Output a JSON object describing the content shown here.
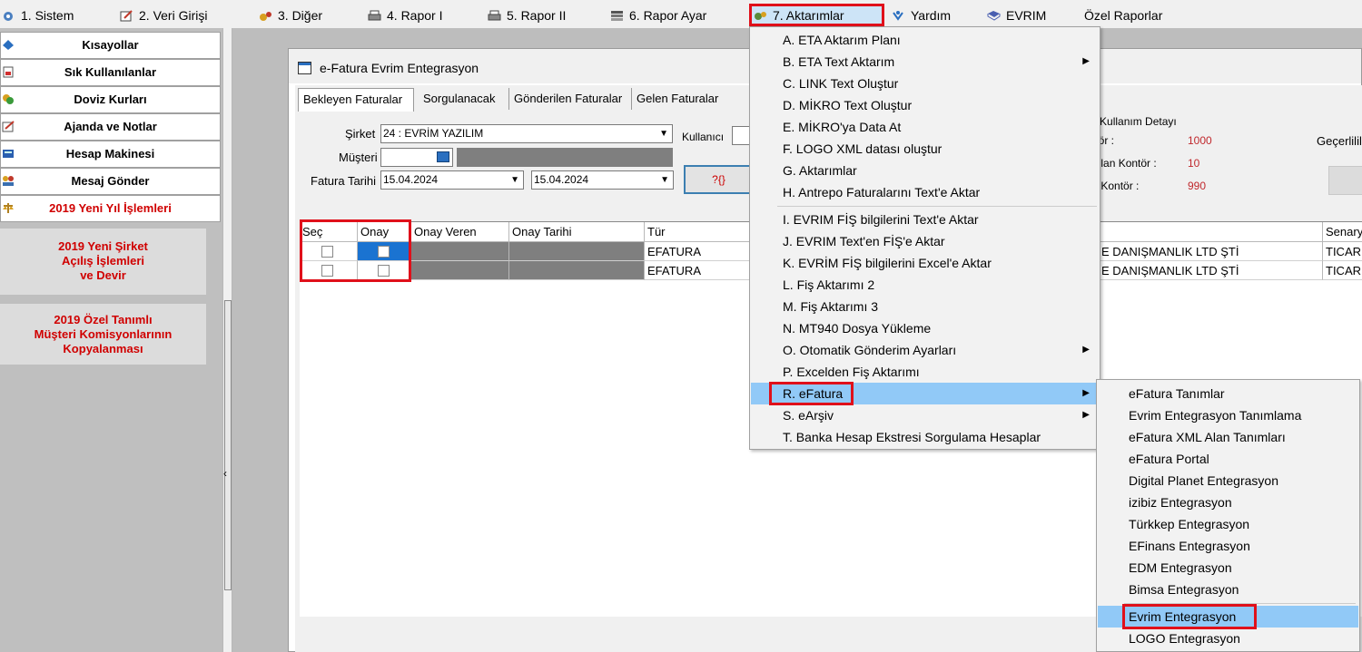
{
  "menubar": {
    "items": [
      {
        "label": "1.  Sistem",
        "icon": "settings-icon"
      },
      {
        "label": "2.  Veri Girişi",
        "icon": "edit-icon"
      },
      {
        "label": "3.  Diğer",
        "icon": "gears-icon"
      },
      {
        "label": "4.  Rapor I",
        "icon": "printer-icon"
      },
      {
        "label": "5.  Rapor II",
        "icon": "printer-icon"
      },
      {
        "label": "6.  Rapor Ayar",
        "icon": "report-settings-icon"
      },
      {
        "label": "7.  Aktarımlar",
        "icon": "transfer-icon"
      },
      {
        "label": "Yardım",
        "icon": "help-icon"
      },
      {
        "label": "EVRIM",
        "icon": "book-icon"
      },
      {
        "label": "Özel Raporlar",
        "icon": ""
      }
    ]
  },
  "leftpanel": {
    "items": [
      {
        "label": "Kısayollar"
      },
      {
        "label": "Sık Kullanılanlar"
      },
      {
        "label": "Doviz Kurları"
      },
      {
        "label": "Ajanda ve Notlar"
      },
      {
        "label": "Hesap Makinesi"
      },
      {
        "label": "Mesaj Gönder"
      },
      {
        "label": "2019 Yeni Yıl İşlemleri"
      }
    ],
    "buttons": [
      {
        "label": "2019 Yeni Şirket\nAçılış İşlemleri\nve Devir"
      },
      {
        "label": "2019 Özel Tanımlı\nMüşteri Komisyonlarının\nKopyalanması"
      }
    ]
  },
  "window": {
    "title": "e-Fatura Evrim Entegrasyon",
    "tabs": [
      "Bekleyen Faturalar",
      "Sorgulanacak",
      "Gönderilen Faturalar",
      "Gelen Faturalar"
    ],
    "form": {
      "sirket_label": "Şirket",
      "sirket_value": "24 : EVRİM YAZILIM",
      "musteri_label": "Müşteri",
      "fatura_tarihi_label": "Fatura Tarihi",
      "date_from": "15.04.2024",
      "date_to": "15.04.2024",
      "kullanici_label": "Kullanıcı",
      "query_button": "?{}"
    },
    "kontor": {
      "title": "ntör Kullanım Detayı",
      "kontor_label": "ontör :",
      "kontor_value": "1000",
      "used_label": "lanılan Kontör :",
      "used_value": "10",
      "remaining_label": "lan Kontör :",
      "remaining_value": "990",
      "gecerlilik_label": "Geçerlilil"
    },
    "grid": {
      "headers": [
        "Seç",
        "Onay",
        "Onay Veren",
        "Onay Tarihi",
        "Tür",
        "Senary"
      ],
      "rows": [
        {
          "tur": "EFATURA",
          "unvan": "E DANIŞMANLIK LTD ŞTİ",
          "senaryo": "TICAR"
        },
        {
          "tur": "EFATURA",
          "unvan": "E DANIŞMANLIK LTD ŞTİ",
          "senaryo": "TICAR"
        }
      ]
    }
  },
  "aktarimlar_menu": {
    "items": [
      {
        "label": "A.   ETA Aktarım Planı"
      },
      {
        "label": "B.   ETA Text Aktarım",
        "has_submenu": true
      },
      {
        "label": "C.   LINK Text Oluştur"
      },
      {
        "label": "D.   MİKRO Text Oluştur"
      },
      {
        "label": "E.   MİKRO'ya  Data  At"
      },
      {
        "label": "F.   LOGO XML datası oluştur"
      },
      {
        "label": "G.   Aktarımlar"
      },
      {
        "label": "H.   Antrepo Faturalarını Text'e Aktar"
      },
      {
        "label": "I.    EVRIM FİŞ bilgilerini Text'e Aktar"
      },
      {
        "label": "J.    EVRIM Text'en FİŞ'e Aktar"
      },
      {
        "label": "K.    EVRİM FİŞ bilgilerini Excel'e Aktar"
      },
      {
        "label": "L.    Fiş Aktarımı 2"
      },
      {
        "label": "M.   Fiş Aktarımı 3"
      },
      {
        "label": "N.   MT940 Dosya Yükleme"
      },
      {
        "label": "O. Otomatik Gönderim Ayarları",
        "has_submenu": true
      },
      {
        "label": "P.   Excelden Fiş Aktarımı"
      },
      {
        "label": "R. eFatura",
        "has_submenu": true
      },
      {
        "label": "S.   eArşiv",
        "has_submenu": true
      },
      {
        "label": "T. Banka Hesap Ekstresi Sorgulama Hesaplar"
      }
    ]
  },
  "efatura_submenu": {
    "items": [
      {
        "label": "eFatura Tanımlar"
      },
      {
        "label": "Evrim Entegrasyon Tanımlama"
      },
      {
        "label": "eFatura XML Alan Tanımları"
      },
      {
        "label": "eFatura Portal"
      },
      {
        "label": "Digital Planet Entegrasyon"
      },
      {
        "label": "izibiz Entegrasyon"
      },
      {
        "label": "Türkkep Entegrasyon"
      },
      {
        "label": "EFinans Entegrasyon"
      },
      {
        "label": "EDM Entegrasyon"
      },
      {
        "label": "Bimsa Entegrasyon"
      },
      {
        "label": "Evrim Entegrasyon"
      },
      {
        "label": "LOGO Entegrasyon"
      }
    ]
  },
  "colors": {
    "highlight": "#91c9f7",
    "red_outline": "#e0101a",
    "grid_fill": "#7f7f7f"
  }
}
